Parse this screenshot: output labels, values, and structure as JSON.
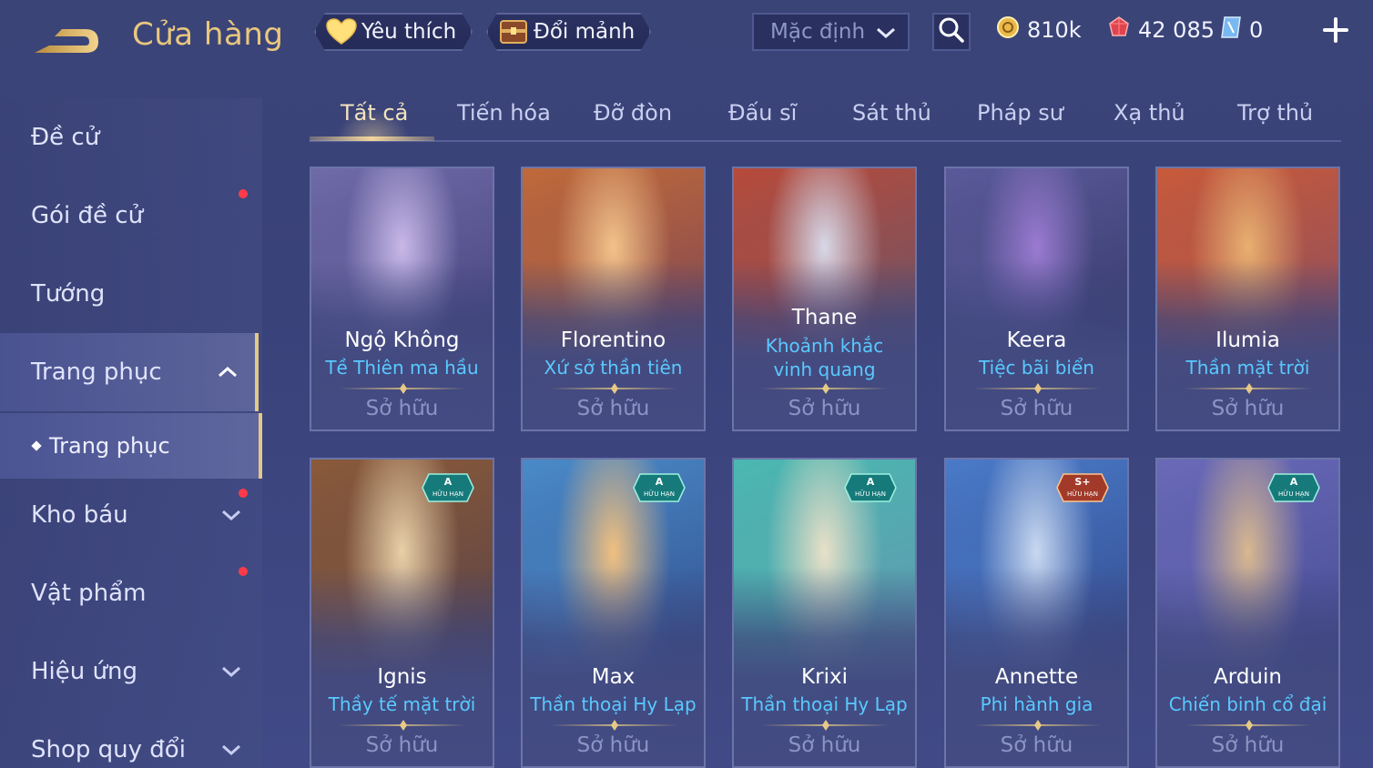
{
  "header": {
    "title": "Cửa hàng",
    "favorites_label": "Yêu thích",
    "exchange_label": "Đổi mảnh",
    "sort_value": "Mặc định",
    "gold": "810k",
    "gems": "42 085",
    "vouchers": "0"
  },
  "sidebar": {
    "items": [
      {
        "label": "Đề cử"
      },
      {
        "label": "Gói đề cử"
      },
      {
        "label": "Tướng"
      },
      {
        "label": "Trang phục"
      },
      {
        "label": "Kho báu"
      },
      {
        "label": "Vật phẩm"
      },
      {
        "label": "Hiệu ứng"
      },
      {
        "label": "Shop quy đổi"
      }
    ],
    "sub_item": "Trang phục"
  },
  "tabs": [
    "Tất cả",
    "Tiến hóa",
    "Đỡ đòn",
    "Đấu sĩ",
    "Sát thủ",
    "Pháp sư",
    "Xạ thủ",
    "Trợ thủ"
  ],
  "cards": [
    {
      "hero": "Ngộ Không",
      "skin": "Tề Thiên ma hầu",
      "status": "Sở hữu",
      "badge_tier": "",
      "badge_text": "",
      "colors": [
        "#6f6aa8",
        "#c8b8e8",
        "#3a3870"
      ]
    },
    {
      "hero": "Florentino",
      "skin": "Xứ sở thần tiên",
      "status": "Sở hữu",
      "badge_tier": "",
      "badge_text": "",
      "colors": [
        "#c06a3a",
        "#f2c28a",
        "#6b3a5a"
      ]
    },
    {
      "hero": "Thane",
      "skin": "Khoảnh khắc vinh quang",
      "status": "Sở hữu",
      "badge_tier": "",
      "badge_text": "",
      "colors": [
        "#b84a3a",
        "#d8d8e8",
        "#505878"
      ]
    },
    {
      "hero": "Keera",
      "skin": "Tiệc bãi biển",
      "status": "Sở hữu",
      "badge_tier": "",
      "badge_text": "",
      "colors": [
        "#5a5a9a",
        "#9a7ad0",
        "#2a2e5a"
      ]
    },
    {
      "hero": "Ilumia",
      "skin": "Thần mặt trời",
      "status": "Sở hữu",
      "badge_tier": "",
      "badge_text": "",
      "colors": [
        "#c85a3a",
        "#e8b070",
        "#7a4a6a"
      ]
    },
    {
      "hero": "Ignis",
      "skin": "Thầy tế mặt trời",
      "status": "Sở hữu",
      "badge_tier": "A",
      "badge_text": "HỮU HẠN",
      "colors": [
        "#8a5a3a",
        "#e8d0a8",
        "#4a3a4a"
      ]
    },
    {
      "hero": "Max",
      "skin": "Thần thoại Hy Lạp",
      "status": "Sở hữu",
      "badge_tier": "A",
      "badge_text": "HỮU HẠN",
      "colors": [
        "#4a8ac8",
        "#f0c080",
        "#2a3a7a"
      ]
    },
    {
      "hero": "Krixi",
      "skin": "Thần thoại Hy Lạp",
      "status": "Sở hữu",
      "badge_tier": "A",
      "badge_text": "HỮU HẠN",
      "colors": [
        "#4ab8b0",
        "#e8e0c8",
        "#6a8ab0"
      ]
    },
    {
      "hero": "Annette",
      "skin": "Phi hành gia",
      "status": "Sở hữu",
      "badge_tier": "S+",
      "badge_text": "HỮU HẠN",
      "colors": [
        "#4a7ac8",
        "#c8d8f0",
        "#2a3a7a"
      ]
    },
    {
      "hero": "Arduin",
      "skin": "Chiến binh cổ đại",
      "status": "Sở hữu",
      "badge_tier": "A",
      "badge_text": "HỮU HẠN",
      "colors": [
        "#6a6ab8",
        "#d8b890",
        "#3a4088"
      ]
    }
  ]
}
